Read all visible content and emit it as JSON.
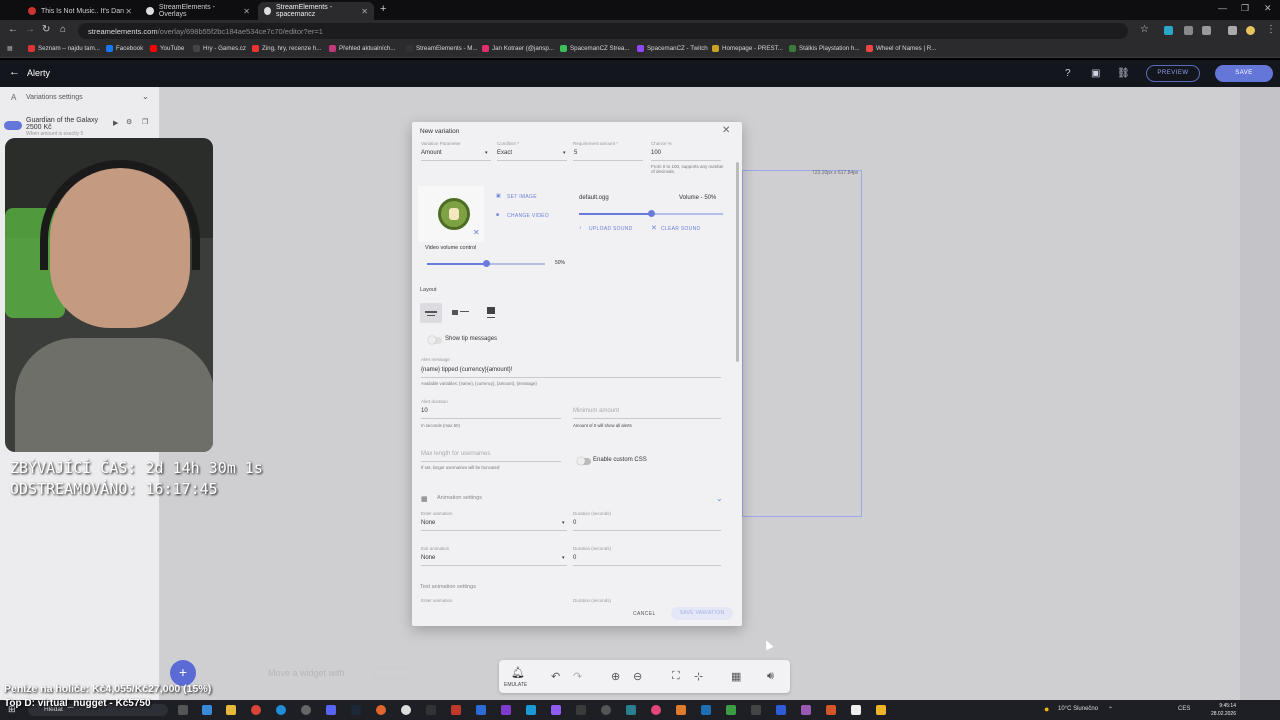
{
  "browser": {
    "tabs": [
      {
        "label": "This Is Not Music.. It's Dan"
      },
      {
        "label": "StreamElements - Overlays"
      },
      {
        "label": "StreamElements - spacemancz"
      }
    ],
    "url_host": "streamelements.com",
    "url_path": "/overlay/698b55f2bc184ae534ce7c70/editor?er=1",
    "bookmarks": [
      {
        "label": "Seznam – najdu tam...",
        "color": "#d33"
      },
      {
        "label": "Facebook",
        "color": "#1877f2"
      },
      {
        "label": "YouTube",
        "color": "#f00"
      },
      {
        "label": "Hry - Games.cz",
        "color": "#444"
      },
      {
        "label": "Zing, hry, recenze h...",
        "color": "#e33"
      },
      {
        "label": "Přehled aktualních...",
        "color": "#c0397b"
      },
      {
        "label": "StreamElements - M...",
        "color": "#333"
      },
      {
        "label": "Jan Kotraer (@jansp...",
        "color": "#e1306c"
      },
      {
        "label": "SpacemanCZ Strea...",
        "color": "#3bbf5a"
      },
      {
        "label": "SpacemanCZ - Twitch",
        "color": "#9146ff"
      },
      {
        "label": "Homepage - PREST...",
        "color": "#c9a227"
      },
      {
        "label": "Stálkis Playstation h...",
        "color": "#3a7a3a"
      },
      {
        "label": "Wheel of Names | R...",
        "color": "#e44"
      }
    ]
  },
  "header": {
    "title": "Alerty",
    "preview_label": "PREVIEW",
    "save_label": "SAVE"
  },
  "leftpanel": {
    "variations_label": "Variations settings",
    "variation_name": "Guardian of the Galaxy 2500 Kč",
    "variation_sub": "When amount is exactly 5"
  },
  "overlay": {
    "timer_remaining": "ZBÝVAJÍCÍ ČAS:  2d 14h 30m 1s",
    "timer_streamed": "ODSTREAMOVÁNO:  16:17:45",
    "goal": "Peníze na holiče: Kč4,055/Kč27,000 (15%)",
    "top_donor": "Top D:  virtual_nugget - Kč5750"
  },
  "canvas": {
    "widget_dims": "723.20px x 617.84px",
    "hint": "Move a widget with"
  },
  "toolbar": {
    "emulate_label": "EMULATE"
  },
  "modal": {
    "title": "New variation",
    "variation_param_label": "Variation Parameter",
    "variation_param": "Amount",
    "condition_label": "Condition *",
    "condition": "Exact",
    "req_amount_label": "Requirement amount *",
    "req_amount": "5",
    "chance_label": "Chance %",
    "chance": "100",
    "chance_hint": "From 0 to 100, supports any number of decimals.",
    "set_image": "SET IMAGE",
    "change_video": "CHANGE VIDEO",
    "sound_file": "default.ogg",
    "volume_label": "Volume - 50%",
    "volume_value": 0.5,
    "upload_sound": "UPLOAD SOUND",
    "clear_sound": "CLEAR SOUND",
    "video_volume_label": "Video volume control",
    "video_volume_pct": "50%",
    "video_volume_value": 0.5,
    "layout_label": "Layout",
    "show_tip": "Show tip messages",
    "alert_message_label": "Alert message",
    "alert_message": "{name} tipped {currency}{amount}!",
    "alert_message_hint": "Available variables: {name}, {currency}, {amount}, {message}",
    "alert_duration_label": "Alert duration",
    "alert_duration": "10",
    "alert_duration_hint": "In seconds (max 50)",
    "min_amount_label": "Minimum amount",
    "min_amount_hint": "Amount of 0 will show all alerts",
    "max_len_label": "Max length for usernames",
    "max_len_hint": "If set, longer usernames will be truncated",
    "custom_css": "Enable custom CSS",
    "animation_settings": "Animation settings",
    "enter_anim_label": "Enter animation",
    "enter_anim": "None",
    "enter_dur_label": "Duration (seconds)",
    "enter_dur": "0",
    "exit_anim_label": "Exit animation",
    "exit_anim": "None",
    "exit_dur_label": "Duration (seconds)",
    "exit_dur": "0",
    "text_anim_settings": "Text animation settings",
    "text_anim_label": "Enter animation",
    "text_dur_label": "Duration (seconds)",
    "cancel": "CANCEL",
    "save_variation": "SAVE VARIATION"
  },
  "taskbar": {
    "search": "Hledat",
    "weather": "10°C  Slunečno",
    "lang": "CES",
    "time": "9:45:14",
    "date": "28.02.2026"
  }
}
